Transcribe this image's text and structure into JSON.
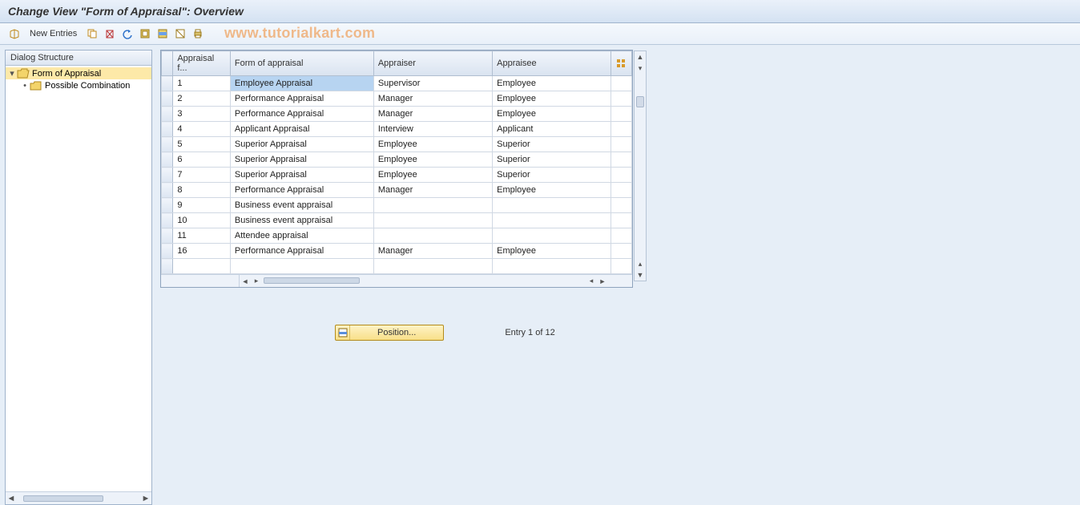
{
  "title": "Change View \"Form of Appraisal\": Overview",
  "toolbar": {
    "new_entries_label": "New Entries"
  },
  "watermark": "www.tutorialkart.com",
  "tree": {
    "header": "Dialog Structure",
    "items": [
      {
        "label": "Form of Appraisal"
      },
      {
        "label": "Possible Combination"
      }
    ]
  },
  "table": {
    "columns": {
      "c0": "Appraisal f...",
      "c1": "Form of appraisal",
      "c2": "Appraiser",
      "c3": "Appraisee"
    },
    "rows": [
      {
        "id": "1",
        "form": "Employee Appraisal",
        "appraiser": "Supervisor",
        "appraisee": "Employee"
      },
      {
        "id": "2",
        "form": "Performance Appraisal",
        "appraiser": "Manager",
        "appraisee": "Employee"
      },
      {
        "id": "3",
        "form": "Performance Appraisal",
        "appraiser": "Manager",
        "appraisee": "Employee"
      },
      {
        "id": "4",
        "form": "Applicant Appraisal",
        "appraiser": "Interview",
        "appraisee": "Applicant"
      },
      {
        "id": "5",
        "form": "Superior Appraisal",
        "appraiser": "Employee",
        "appraisee": "Superior"
      },
      {
        "id": "6",
        "form": "Superior Appraisal",
        "appraiser": "Employee",
        "appraisee": "Superior"
      },
      {
        "id": "7",
        "form": "Superior Appraisal",
        "appraiser": "Employee",
        "appraisee": "Superior"
      },
      {
        "id": "8",
        "form": "Performance Appraisal",
        "appraiser": "Manager",
        "appraisee": "Employee"
      },
      {
        "id": "9",
        "form": "Business event appraisal",
        "appraiser": "",
        "appraisee": ""
      },
      {
        "id": "10",
        "form": "Business event appraisal",
        "appraiser": "",
        "appraisee": ""
      },
      {
        "id": "11",
        "form": "Attendee appraisal",
        "appraiser": "",
        "appraisee": ""
      },
      {
        "id": "16",
        "form": "Performance Appraisal",
        "appraiser": "Manager",
        "appraisee": "Employee"
      },
      {
        "id": "",
        "form": "",
        "appraiser": "",
        "appraisee": ""
      }
    ]
  },
  "footer": {
    "position_label": "Position...",
    "entry_text": "Entry 1 of 12"
  }
}
